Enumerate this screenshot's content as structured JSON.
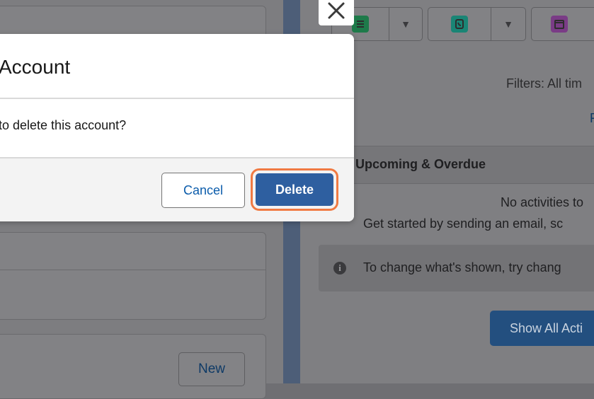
{
  "modal": {
    "title": "Account",
    "message": "to delete this account?",
    "cancel_label": "Cancel",
    "delete_label": "Delete",
    "close_icon": "close-icon",
    "highlight_color": "#f07a43",
    "primary_color": "#2e5fa0"
  },
  "background": {
    "new_button_label": "New",
    "filters_text": "Filters: All tim",
    "filters_link": "F",
    "section_title": "Upcoming & Overdue",
    "no_activities": "No activities to",
    "get_started": "Get started by sending an email, sc",
    "info_text": "To change what's shown, try chang",
    "show_all_label": "Show All Acti",
    "toolbar_icons": [
      "task-icon",
      "log-call-icon",
      "event-icon"
    ]
  }
}
